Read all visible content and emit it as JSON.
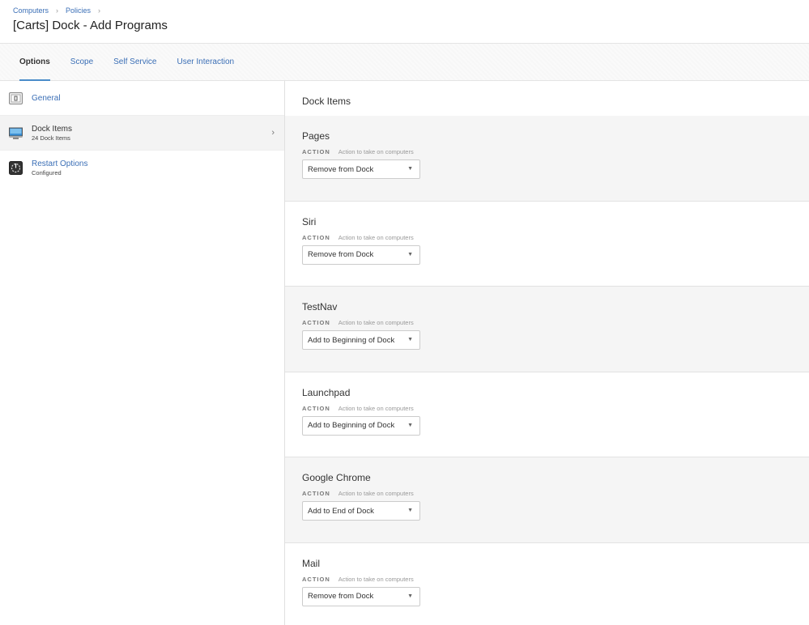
{
  "breadcrumb": [
    "Computers",
    "Policies"
  ],
  "page_title": "[Carts] Dock - Add Programs",
  "tabs": [
    {
      "label": "Options",
      "active": true
    },
    {
      "label": "Scope",
      "active": false
    },
    {
      "label": "Self Service",
      "active": false
    },
    {
      "label": "User Interaction",
      "active": false
    }
  ],
  "sidebar": {
    "items": [
      {
        "label": "General",
        "sub": "",
        "icon": "general-icon"
      },
      {
        "label": "Dock Items",
        "sub": "24 Dock Items",
        "icon": "dock-icon",
        "active": true
      },
      {
        "label": "Restart Options",
        "sub": "Configured",
        "icon": "restart-icon"
      }
    ]
  },
  "main": {
    "title": "Dock Items",
    "action_label": "ACTION",
    "action_help": "Action to take on computers",
    "items": [
      {
        "name": "Pages",
        "action": "Remove from Dock"
      },
      {
        "name": "Siri",
        "action": "Remove from Dock"
      },
      {
        "name": "TestNav",
        "action": "Add to Beginning of Dock"
      },
      {
        "name": "Launchpad",
        "action": "Add to Beginning of Dock"
      },
      {
        "name": "Google Chrome",
        "action": "Add to End of Dock"
      },
      {
        "name": "Mail",
        "action": "Remove from Dock"
      }
    ]
  }
}
